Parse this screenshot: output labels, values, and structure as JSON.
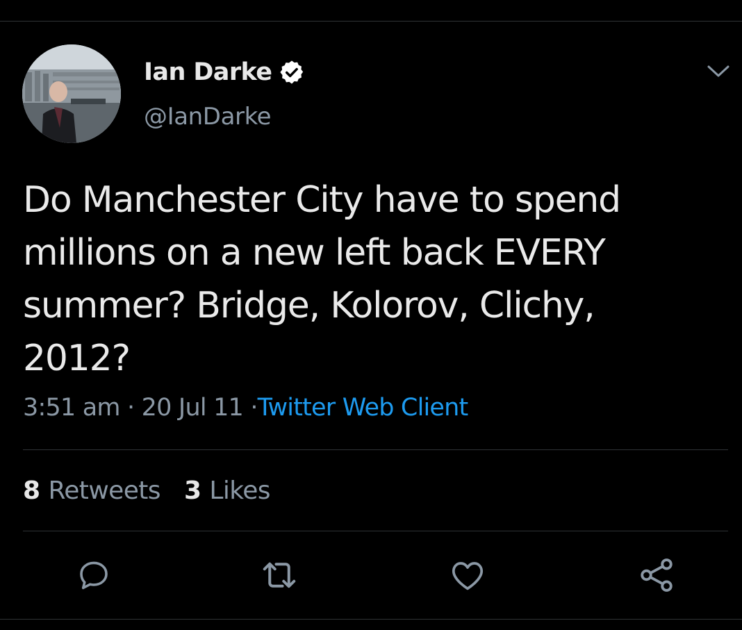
{
  "tweet": {
    "author": {
      "display_name": "Ian Darke",
      "handle": "@IanDarke",
      "verified": true,
      "avatar_icon": "avatar-photo"
    },
    "text": "Do Manchester City have to spend\nmillions on a new left back EVERY\nsummer?  Bridge, Kolorov, Clichy,\n2012?",
    "time": "3:51 am",
    "separator": "·",
    "date": "20 Jul 11",
    "source": "Twitter Web Client",
    "stats": {
      "retweets_count": "8",
      "retweets_label": "Retweets",
      "likes_count": "3",
      "likes_label": "Likes"
    },
    "actions": [
      {
        "name": "reply",
        "icon": "speech-bubble-icon"
      },
      {
        "name": "retweet",
        "icon": "retweet-icon"
      },
      {
        "name": "like",
        "icon": "heart-icon"
      },
      {
        "name": "share",
        "icon": "share-icon"
      }
    ]
  },
  "colors": {
    "background": "#000000",
    "primary_text": "#e8e8e8",
    "secondary_text": "#8b98a5",
    "link": "#1d9bf0",
    "divider": "#2f3336",
    "verified_badge": "#ffffff"
  }
}
